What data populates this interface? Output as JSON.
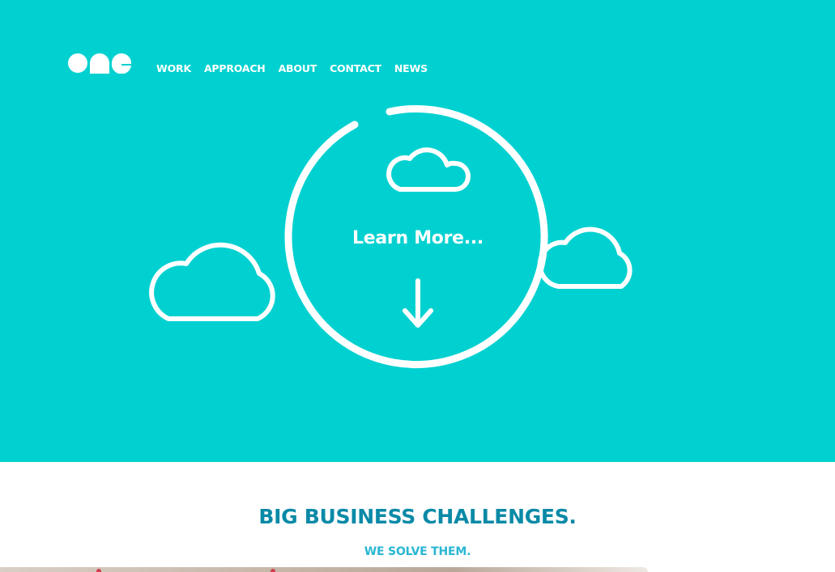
{
  "brand": {
    "logo_text": "one"
  },
  "nav": {
    "items": [
      {
        "label": "WORK"
      },
      {
        "label": "APPROACH"
      },
      {
        "label": "ABOUT"
      },
      {
        "label": "CONTACT"
      },
      {
        "label": "NEWS"
      }
    ]
  },
  "hero": {
    "cta_label": "Learn More...",
    "icons": [
      "cloud-icon",
      "cloud-icon",
      "cloud-icon",
      "down-arrow-icon"
    ],
    "colors": {
      "background": "#00d1d0",
      "foreground": "#ffffff"
    }
  },
  "intro": {
    "headline": "BIG BUSINESS CHALLENGES.",
    "subheadline": "WE SOLVE THEM.",
    "colors": {
      "headline": "#0a8aa7",
      "subheadline": "#2ab6d3"
    }
  }
}
